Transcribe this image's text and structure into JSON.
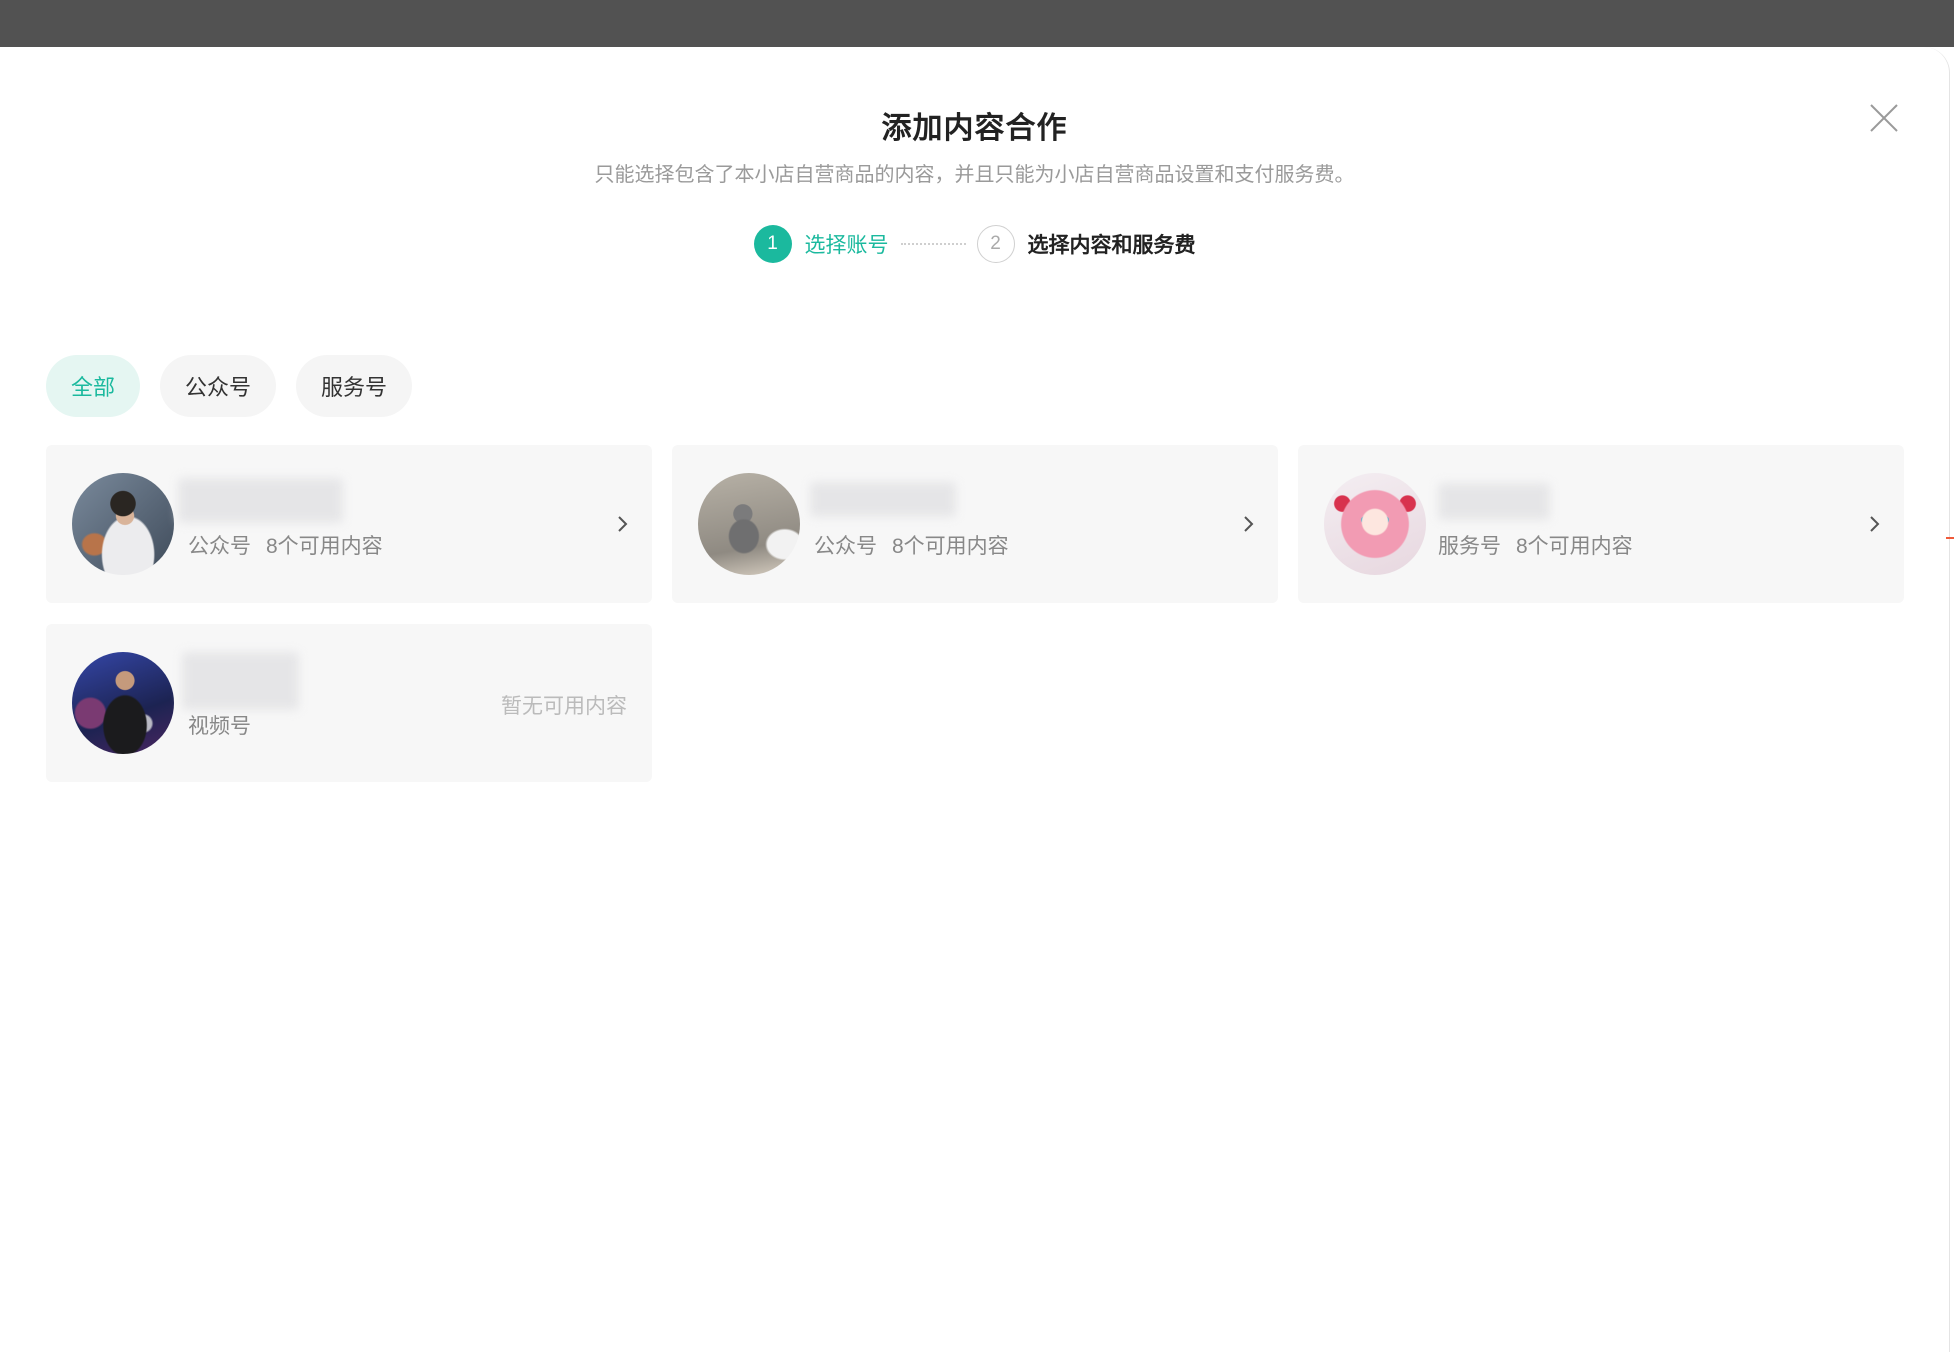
{
  "modal": {
    "title": "添加内容合作",
    "subtitle": "只能选择包含了本小店自营商品的内容，并且只能为小店自营商品设置和支付服务费。",
    "close_icon": "close-icon"
  },
  "steps": [
    {
      "number": "1",
      "label": "选择账号",
      "active": true
    },
    {
      "number": "2",
      "label": "选择内容和服务费",
      "active": false
    }
  ],
  "filters": [
    {
      "label": "全部",
      "selected": true
    },
    {
      "label": "公众号",
      "selected": false
    },
    {
      "label": "服务号",
      "selected": false
    }
  ],
  "accounts": [
    {
      "type": "公众号",
      "count": "8个可用内容",
      "avatar_icon": "avatar"
    },
    {
      "type": "公众号",
      "count": "8个可用内容",
      "avatar_icon": "avatar"
    },
    {
      "type": "服务号",
      "count": "8个可用内容",
      "avatar_icon": "avatar"
    },
    {
      "type": "视频号",
      "status": "暂无可用内容",
      "avatar_icon": "avatar"
    }
  ],
  "icons": {
    "chevron": "chevron-right-icon",
    "close": "close-icon"
  },
  "colors": {
    "accent": "#1bb99e",
    "accent_light": "#e5f6f2",
    "card_background": "#f7f7f7",
    "backdrop": "#525252"
  }
}
